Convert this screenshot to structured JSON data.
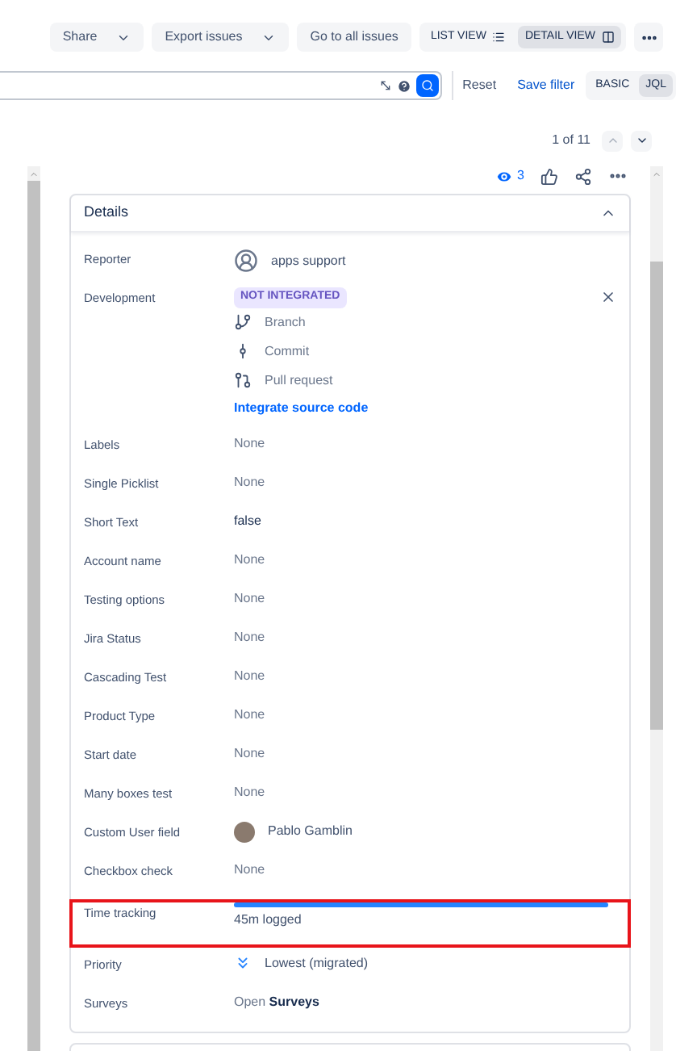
{
  "toolbar": {
    "buttons": [
      {
        "label": "Share",
        "kind": "dropdown"
      },
      {
        "label": "Export issues",
        "kind": "dropdown"
      },
      {
        "label": "Go to all issues",
        "kind": "plain"
      }
    ],
    "views": [
      {
        "label": "LIST VIEW",
        "kind": "list",
        "selected": false
      },
      {
        "label": "DETAIL VIEW",
        "kind": "detail",
        "selected": true
      }
    ]
  },
  "search": {
    "reset": "Reset",
    "save_filter": "Save filter",
    "modes": [
      {
        "label": "BASIC",
        "selected": false
      },
      {
        "label": "JQL",
        "selected": true
      }
    ]
  },
  "pagination": "1 of 11",
  "watchers": "3",
  "details": {
    "title": "Details",
    "expanded": true,
    "fields": [
      {
        "label": "Reporter",
        "kind": "default_user",
        "value": "apps support"
      },
      {
        "label": "Development",
        "kind": "development",
        "badge": "NOT INTEGRATED",
        "items": [
          {
            "label": "Branch",
            "kind": "branch"
          },
          {
            "label": "Commit",
            "kind": "commit"
          },
          {
            "label": "Pull request",
            "kind": "pull"
          }
        ],
        "link": "Integrate source code"
      },
      {
        "label": "Labels",
        "kind": "empty",
        "value": "None"
      },
      {
        "label": "Single Picklist",
        "kind": "empty",
        "value": "None"
      },
      {
        "label": "Short Text",
        "kind": "text",
        "value": "false"
      },
      {
        "label": "Account name",
        "kind": "empty",
        "value": "None"
      },
      {
        "label": "Testing options",
        "kind": "empty",
        "value": "None"
      },
      {
        "label": "Jira Status",
        "kind": "empty",
        "value": "None"
      },
      {
        "label": "Cascading Test",
        "kind": "empty",
        "value": "None"
      },
      {
        "label": "Product Type",
        "kind": "empty",
        "value": "None"
      },
      {
        "label": "Start date",
        "kind": "empty",
        "value": "None"
      },
      {
        "label": "Many boxes test",
        "kind": "empty",
        "value": "None"
      },
      {
        "label": "Custom User field",
        "kind": "user",
        "value": "Pablo Gamblin"
      },
      {
        "label": "Checkbox check",
        "kind": "empty",
        "value": "None"
      },
      {
        "label": "Time tracking",
        "kind": "time",
        "level": 1,
        "value": "45m logged",
        "highlighted": true
      },
      {
        "label": "Priority",
        "kind": "priority",
        "value": "Lowest (migrated)"
      },
      {
        "label": "Surveys",
        "kind": "rich",
        "value": "Open **Surveys**"
      }
    ]
  }
}
